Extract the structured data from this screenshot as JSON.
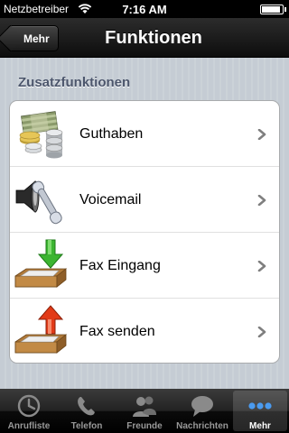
{
  "status_bar": {
    "carrier": "Netzbetreiber",
    "time": "7:16 AM",
    "battery_level": 0.9
  },
  "nav_bar": {
    "back_label": "Mehr",
    "title": "Funktionen"
  },
  "section": {
    "header": "Zusatzfunktionen",
    "items": [
      {
        "label": "Guthaben",
        "icon": "money-stack-icon"
      },
      {
        "label": "Voicemail",
        "icon": "voicemail-phone-icon"
      },
      {
        "label": "Fax Eingang",
        "icon": "fax-inbox-icon"
      },
      {
        "label": "Fax senden",
        "icon": "fax-outbox-icon"
      }
    ]
  },
  "tab_bar": {
    "tabs": [
      {
        "label": "Anrufliste",
        "icon": "call-log-icon",
        "selected": false
      },
      {
        "label": "Telefon",
        "icon": "phone-icon",
        "selected": false
      },
      {
        "label": "Freunde",
        "icon": "friends-icon",
        "selected": false
      },
      {
        "label": "Nachrichten",
        "icon": "messages-icon",
        "selected": false
      },
      {
        "label": "Mehr",
        "icon": "more-icon",
        "selected": true
      }
    ]
  },
  "colors": {
    "background": "#c5ccd4",
    "section_header": "#4c566c",
    "accent_green": "#3cb531",
    "accent_red": "#e23a17",
    "tab_more_blue": "#4a9bf0"
  }
}
